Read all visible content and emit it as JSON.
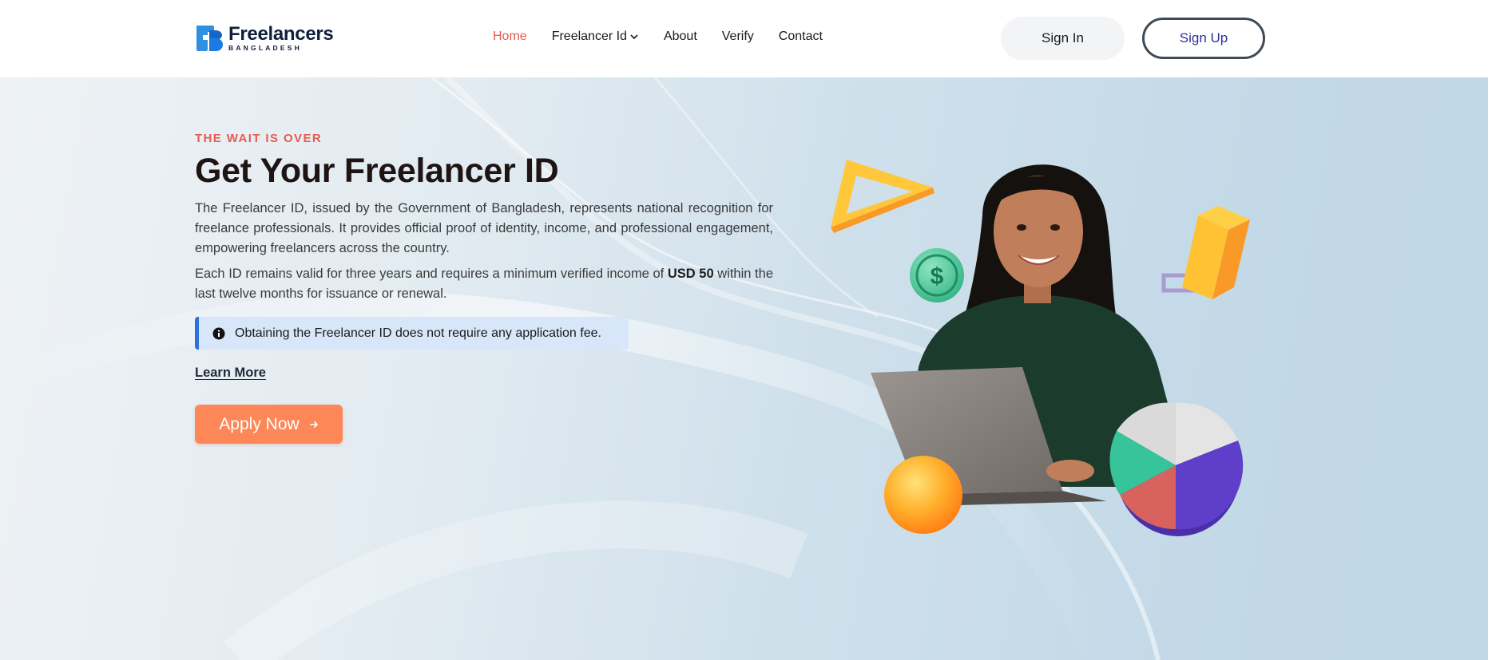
{
  "brand": {
    "name": "Freelancers",
    "subtitle": "BANGLADESH",
    "colors": {
      "primary": "#2f6fdc",
      "accent": "#ea5a4e",
      "cta": "#fd8756",
      "navy": "#0f1f3a"
    }
  },
  "nav": {
    "items": [
      {
        "label": "Home",
        "active": true
      },
      {
        "label": "Freelancer Id",
        "has_dropdown": true
      },
      {
        "label": "About"
      },
      {
        "label": "Verify"
      },
      {
        "label": "Contact"
      }
    ],
    "sign_in": "Sign In",
    "sign_up": "Sign Up"
  },
  "hero": {
    "eyebrow": "THE WAIT IS OVER",
    "title": "Get Your Freelancer ID",
    "paragraph1": "The Freelancer ID, issued by the Government of Bangladesh, represents national recognition for freelance professionals. It provides official proof of identity, income, and professional engagement, empowering freelancers across the country.",
    "paragraph2_before": "Each ID remains valid for three years and requires a minimum verified income of ",
    "paragraph2_bold": "USD 50",
    "paragraph2_after": " within the last twelve months for issuance or renewal.",
    "notice": "Obtaining the Freelancer ID does not require any application fee.",
    "learn_more": "Learn More",
    "apply": "Apply Now",
    "dollar_symbol": "$"
  },
  "icons": {
    "dropdown": "chevron-down-icon",
    "info": "info-circle-icon",
    "arrow": "arrow-right-icon",
    "logo": "fb-logo-icon"
  }
}
